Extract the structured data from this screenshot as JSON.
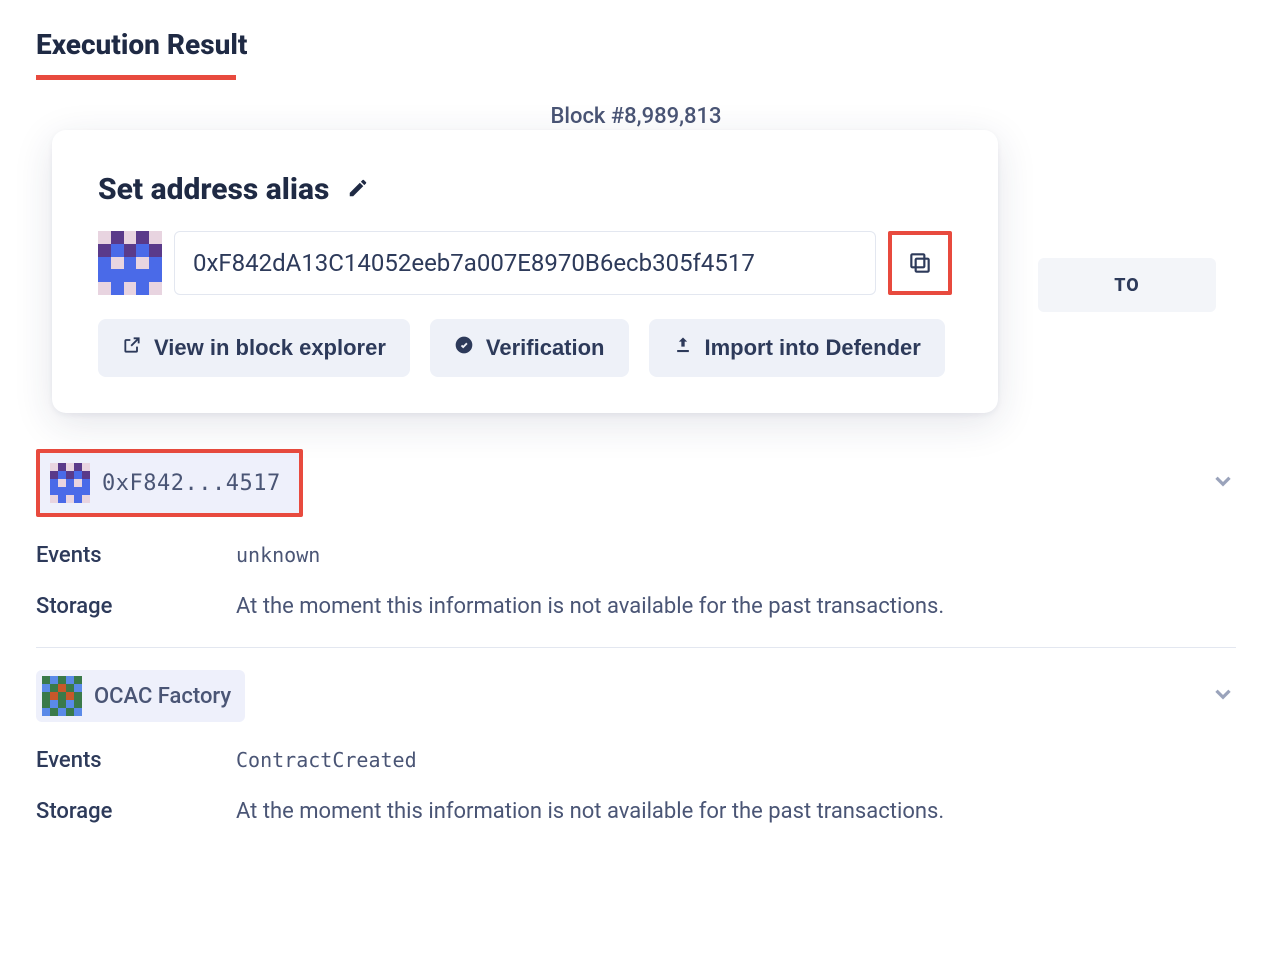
{
  "section_title": "Execution Result",
  "block_label": "Block #8,989,813",
  "popover": {
    "title": "Set address alias",
    "address": "0xF842dA13C14052eeb7a007E8970B6ecb305f4517",
    "actions": {
      "view": "View in block explorer",
      "verify": "Verification",
      "import": "Import into Defender"
    }
  },
  "to_label": "TO",
  "entries": [
    {
      "chip_text": "0xF842...4517",
      "events_label": "Events",
      "events_value": "unknown",
      "storage_label": "Storage",
      "storage_value": "At the moment this information is not available for the past transactions."
    },
    {
      "chip_text": "OCAC Factory",
      "events_label": "Events",
      "events_value": "ContractCreated",
      "storage_label": "Storage",
      "storage_value": "At the moment this information is not available for the past transactions."
    }
  ]
}
